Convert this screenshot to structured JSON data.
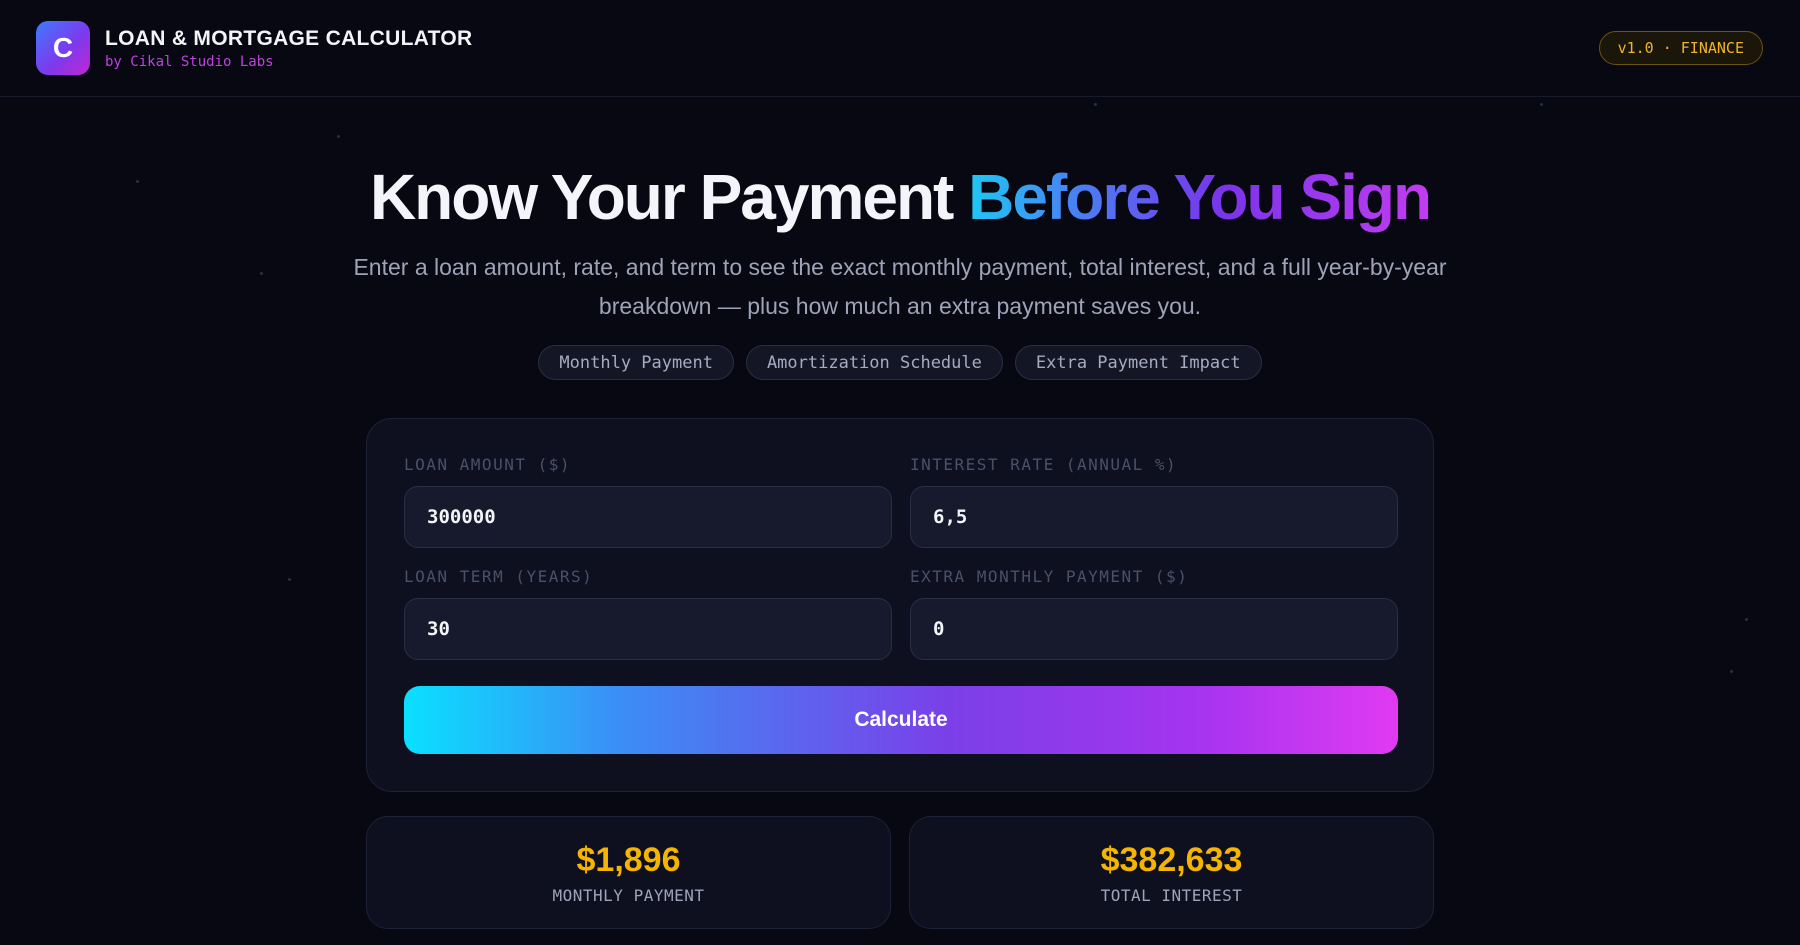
{
  "header": {
    "logo_letter": "C",
    "title": "LOAN & MORTGAGE CALCULATOR",
    "subtitle": "by Cikal Studio Labs",
    "version": "v1.0 · FINANCE"
  },
  "hero": {
    "title_plain": "Know Your Payment ",
    "title_highlight": "Before You Sign",
    "description": "Enter a loan amount, rate, and term to see the exact monthly payment, total interest, and a full year-by-year breakdown — plus how much an extra payment saves you.",
    "tags": [
      "Monthly Payment",
      "Amortization Schedule",
      "Extra Payment Impact"
    ]
  },
  "form": {
    "loan_amount_label": "LOAN AMOUNT ($)",
    "loan_amount_value": "300000",
    "interest_rate_label": "INTEREST RATE (ANNUAL %)",
    "interest_rate_value": "6,5",
    "loan_term_label": "LOAN TERM (YEARS)",
    "loan_term_value": "30",
    "extra_payment_label": "EXTRA MONTHLY PAYMENT ($)",
    "extra_payment_value": "0",
    "calculate_label": "Calculate"
  },
  "results": {
    "monthly_payment_value": "$1,896",
    "monthly_payment_label": "MONTHLY PAYMENT",
    "total_interest_value": "$382,633",
    "total_interest_label": "TOTAL INTEREST"
  },
  "colors": {
    "background": "#070812",
    "accent_gold": "#f5b400",
    "accent_magenta": "#c042e0",
    "accent_cyan": "#0ae0ff"
  }
}
